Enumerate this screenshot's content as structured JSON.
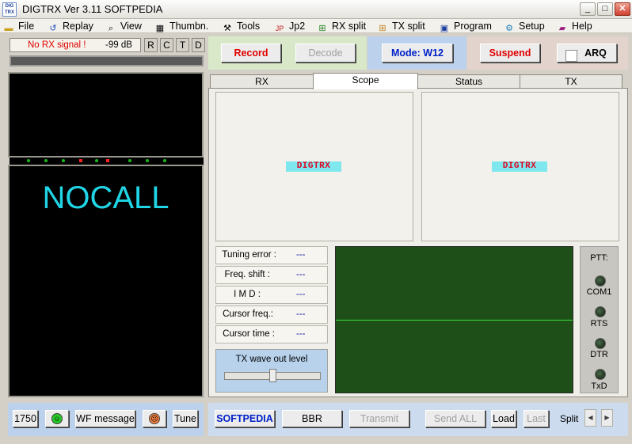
{
  "window": {
    "title": "DIGTRX  Ver 3.11     SOFTPEDIA",
    "logo_text": "DIG TRX",
    "controls": [
      "_",
      "□",
      "✕"
    ]
  },
  "menu": [
    {
      "label": "File",
      "icon": "folder-icon"
    },
    {
      "label": "Replay",
      "icon": "replay-icon"
    },
    {
      "label": "View",
      "icon": "magnifier-icon"
    },
    {
      "label": "Thumbn.",
      "icon": "grid-icon"
    },
    {
      "label": "Tools",
      "icon": "tools-icon"
    },
    {
      "label": "Jp2",
      "icon": "jp2-icon"
    },
    {
      "label": "RX split",
      "icon": "rx-split-icon"
    },
    {
      "label": "TX split",
      "icon": "tx-split-icon"
    },
    {
      "label": "Program",
      "icon": "program-icon"
    },
    {
      "label": "Setup",
      "icon": "setup-icon"
    },
    {
      "label": "Help",
      "icon": "help-book-icon"
    }
  ],
  "rx": {
    "signal_text": "No RX signal !",
    "db": "-99 dB",
    "flags": [
      "R",
      "C",
      "T",
      "D"
    ],
    "callsign": "NOCALL"
  },
  "controls": {
    "record": "Record",
    "decode": "Decode",
    "mode": "Mode: W12",
    "suspend": "Suspend",
    "arq": "ARQ"
  },
  "tabs": [
    "RX",
    "Scope",
    "Status",
    "TX"
  ],
  "active_tab": "Scope",
  "scope": {
    "logo_left": "DIGTRX",
    "logo_right": "DIGTRX"
  },
  "measurements": [
    {
      "label": "Tuning error :",
      "value": "---"
    },
    {
      "label": "Freq. shift :",
      "value": "---"
    },
    {
      "label": "I M D :",
      "value": "---"
    },
    {
      "label": "Cursor freq.:",
      "value": "---"
    },
    {
      "label": "Cursor time :",
      "value": "---"
    }
  ],
  "tx_wave": {
    "label": "TX wave out level",
    "level": 0.5
  },
  "ptt": {
    "label": "PTT:",
    "ports": [
      "COM1",
      "RTS",
      "DTR",
      "TxD"
    ]
  },
  "bottom_left": {
    "freq": "1750",
    "wf_message": "WF message",
    "tune": "Tune"
  },
  "bottom_right": {
    "softpedia": "SOFTPEDIA",
    "bbr": "BBR",
    "transmit": "Transmit",
    "send_all": "Send ALL",
    "load": "Load",
    "last": "Last",
    "split": "Split"
  },
  "colors": {
    "callsign": "#20d6e6",
    "scope_bg": "#1e4f18",
    "trace": "#38e83a",
    "record_red": "#e00000",
    "mode_blue": "#0020c8"
  }
}
